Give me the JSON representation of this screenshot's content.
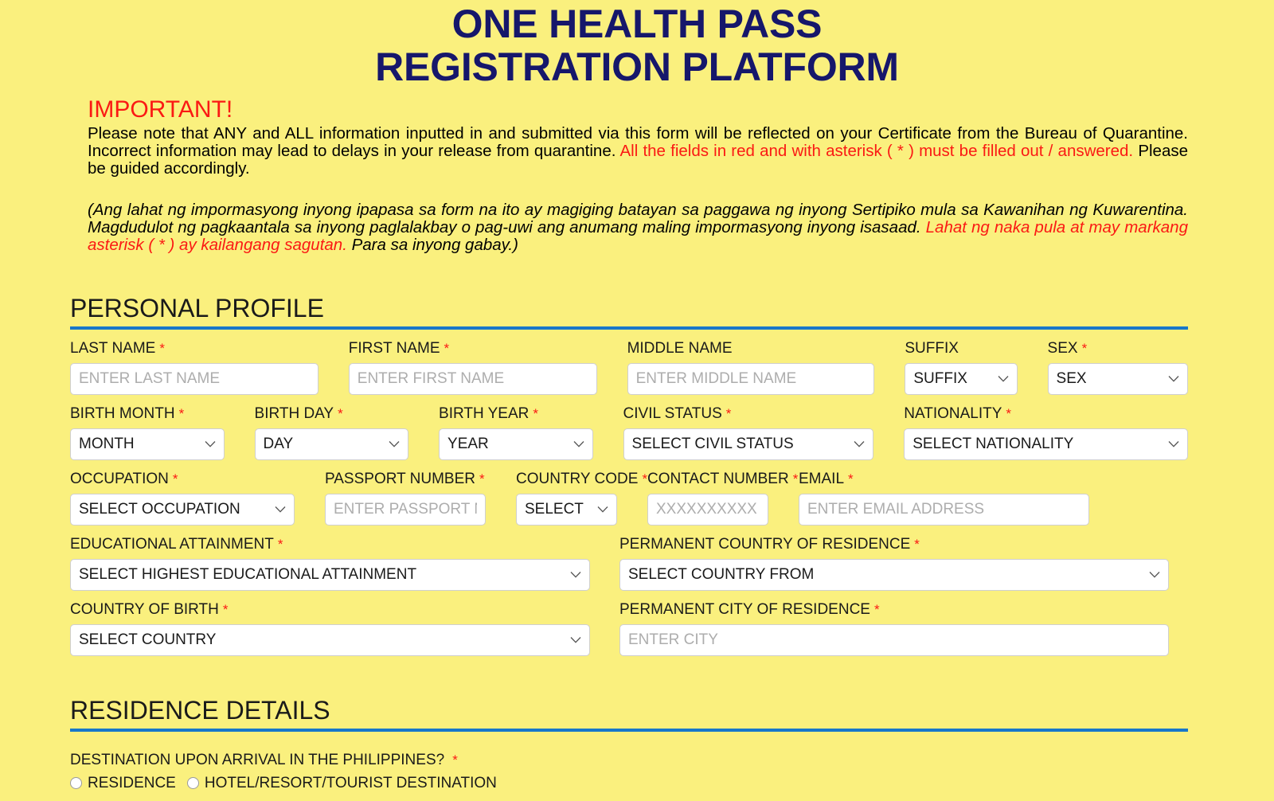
{
  "header": {
    "title_line1": "ONE HEALTH PASS",
    "title_line2": "REGISTRATION PLATFORM",
    "title_color": "#16176b"
  },
  "notice": {
    "important_heading": "IMPORTANT!",
    "english_part1": "Please note that ANY and ALL information inputted in and submitted via this form will be reflected on your Certificate from the Bureau of Quarantine. Incorrect information may lead to delays in your release from quarantine. ",
    "english_red": "All the fields in red and with asterisk ( * ) must be filled out / answered.",
    "english_part2": " Please be guided accordingly.",
    "filipino_part1": "(Ang lahat ng impormasyong inyong ipapasa sa form na ito ay magiging batayan sa paggawa ng inyong Sertipiko mula sa Kawanihan ng Kuwarentina. Magdudulot ng pagkaantala sa inyong paglalakbay o pag-uwi ang anumang maling impormasyong inyong isasaad. ",
    "filipino_red": "Lahat ng naka pula at may markang asterisk ( * ) ay kailangang sagutan.",
    "filipino_part2": " Para sa inyong gabay.)",
    "red_color": "#fa1914"
  },
  "sections": {
    "personal_profile": "PERSONAL PROFILE",
    "residence_details": "RESIDENCE DETAILS",
    "rule_color": "#1877c9"
  },
  "personal": {
    "last_name": {
      "label": "LAST NAME",
      "required": "*",
      "placeholder": "ENTER LAST NAME"
    },
    "first_name": {
      "label": "FIRST NAME",
      "required": "*",
      "placeholder": "ENTER FIRST NAME"
    },
    "middle_name": {
      "label": "MIDDLE NAME",
      "required": "",
      "placeholder": "ENTER MIDDLE NAME"
    },
    "suffix": {
      "label": "SUFFIX",
      "required": "",
      "value": "SUFFIX"
    },
    "sex": {
      "label": "SEX",
      "required": "*",
      "value": "SEX"
    },
    "birth_month": {
      "label": "BIRTH MONTH",
      "required": "*",
      "value": "MONTH"
    },
    "birth_day": {
      "label": "BIRTH DAY",
      "required": "*",
      "value": "DAY"
    },
    "birth_year": {
      "label": "BIRTH YEAR",
      "required": "*",
      "value": "YEAR"
    },
    "civil_status": {
      "label": "CIVIL STATUS",
      "required": "*",
      "value": "SELECT CIVIL STATUS"
    },
    "nationality": {
      "label": "NATIONALITY",
      "required": "*",
      "value": "SELECT NATIONALITY"
    },
    "occupation": {
      "label": "OCCUPATION",
      "required": "*",
      "value": "SELECT OCCUPATION"
    },
    "passport_number": {
      "label": "PASSPORT NUMBER",
      "required": "*",
      "placeholder": "ENTER PASSPORT NUMBER"
    },
    "country_code": {
      "label": "COUNTRY CODE",
      "required": "*",
      "value": "SELECT"
    },
    "contact_number": {
      "label": "CONTACT NUMBER",
      "required": "*",
      "placeholder": "XXXXXXXXXX"
    },
    "email": {
      "label": "EMAIL",
      "required": "*",
      "placeholder": "ENTER EMAIL ADDRESS"
    },
    "educational_attainment": {
      "label": "EDUCATIONAL ATTAINMENT",
      "required": "*",
      "value": "SELECT HIGHEST EDUCATIONAL ATTAINMENT"
    },
    "permanent_country_of_residence": {
      "label": "PERMANENT COUNTRY OF RESIDENCE",
      "required": "*",
      "value": "SELECT COUNTRY FROM"
    },
    "country_of_birth": {
      "label": "COUNTRY OF BIRTH",
      "required": "*",
      "value": "SELECT COUNTRY"
    },
    "permanent_city_of_residence": {
      "label": "PERMANENT CITY OF RESIDENCE",
      "required": "*",
      "placeholder": "ENTER CITY"
    }
  },
  "residence": {
    "destination_question": "DESTINATION UPON ARRIVAL IN THE PHILIPPINES?",
    "destination_required": "*",
    "options": [
      {
        "label": "RESIDENCE"
      },
      {
        "label": "HOTEL/RESORT/TOURIST DESTINATION"
      }
    ]
  }
}
